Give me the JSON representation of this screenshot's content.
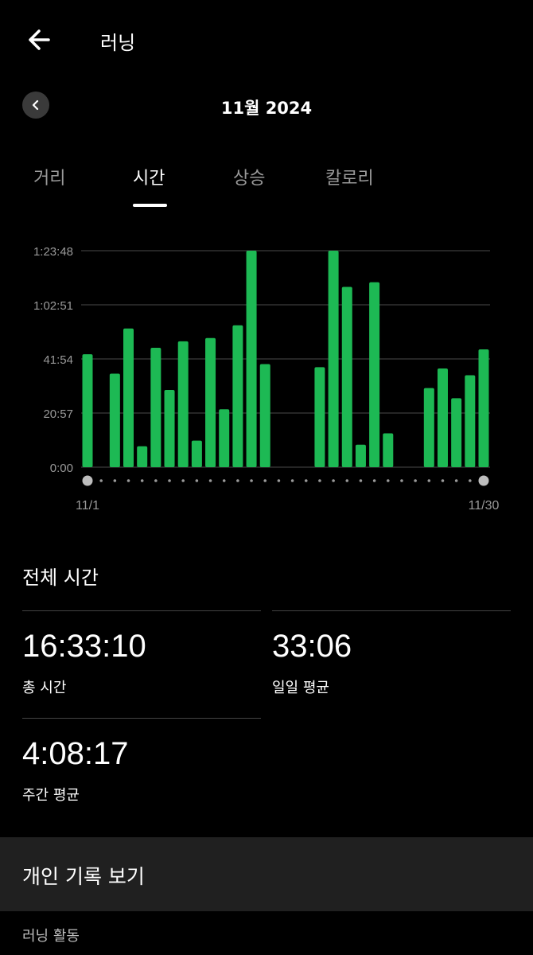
{
  "header": {
    "title": "러닝",
    "back_icon": "arrow-left-icon"
  },
  "month": {
    "label": "11월 2024",
    "prev_icon": "chevron-left-icon"
  },
  "tabs": [
    {
      "label": "거리",
      "active": false
    },
    {
      "label": "시간",
      "active": true
    },
    {
      "label": "상승",
      "active": false
    },
    {
      "label": "칼로리",
      "active": false
    }
  ],
  "colors": {
    "bar": "#1db954",
    "background": "#000000",
    "grid": "#4a4a4a"
  },
  "chart_data": {
    "type": "bar",
    "x_start_label": "11/1",
    "x_end_label": "11/30",
    "y_tick_labels": [
      "0:00",
      "20:57",
      "41:54",
      "1:02:51",
      "1:23:48"
    ],
    "ylim_minutes": [
      0,
      83.8
    ],
    "days": [
      1,
      2,
      3,
      4,
      5,
      6,
      7,
      8,
      9,
      10,
      11,
      12,
      13,
      14,
      15,
      16,
      17,
      18,
      19,
      20,
      21,
      22,
      23,
      24,
      25,
      26,
      27,
      28,
      29,
      30
    ],
    "minutes": [
      43.7,
      0,
      36.2,
      53.7,
      8.1,
      46.2,
      29.9,
      48.7,
      10.3,
      50.0,
      22.4,
      54.9,
      83.8,
      39.9,
      0,
      0,
      0,
      38.7,
      83.8,
      69.8,
      8.7,
      71.6,
      13.1,
      0,
      0,
      30.6,
      38.2,
      26.7,
      35.6,
      45.6
    ]
  },
  "totals": {
    "section_title": "전체 시간",
    "total_value": "16:33:10",
    "total_label": "총 시간",
    "daily_value": "33:06",
    "daily_label": "일일 평균",
    "weekly_value": "4:08:17",
    "weekly_label": "주간 평균"
  },
  "records": {
    "label": "개인 기록 보기"
  },
  "activity": {
    "label": "러닝 활동"
  }
}
